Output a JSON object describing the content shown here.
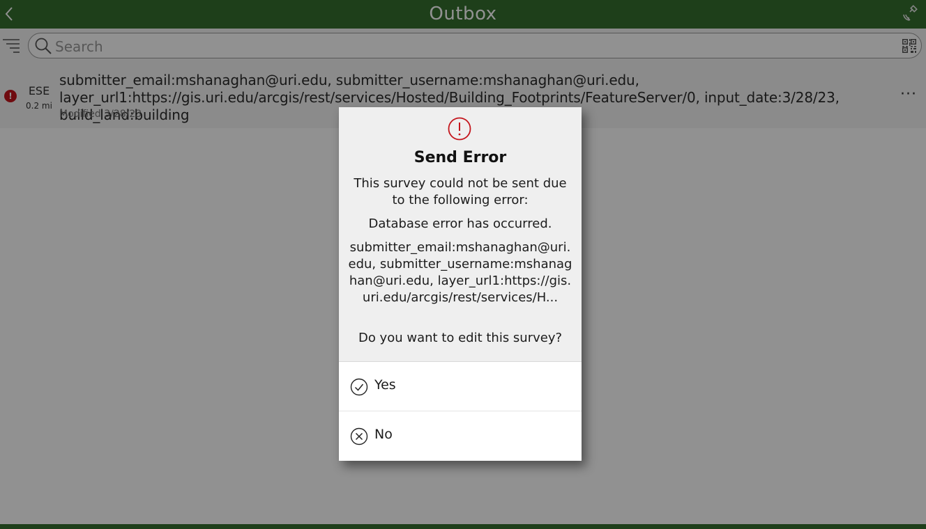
{
  "header": {
    "title": "Outbox",
    "back_icon": "chevron-left-icon",
    "gps_icon": "gps-satellite-icon"
  },
  "search": {
    "placeholder": "Search",
    "value": "",
    "filter_icon": "filter-list-icon",
    "qr_icon": "qr-code-icon"
  },
  "list": {
    "items": [
      {
        "status_icon": "error-icon",
        "direction": "ESE",
        "distance": "0.2 mi",
        "text": "submitter_email:mshanaghan@uri.edu, submitter_username:mshanaghan@uri.edu, layer_url1:https://gis.uri.edu/arcgis/rest/services/Hosted/Building_Footprints/FeatureServer/0, input_date:3/28/23, build_land:building",
        "modified": "Modified 3/28/23",
        "more_label": "···"
      }
    ]
  },
  "dialog": {
    "title": "Send Error",
    "message": "This survey could not be sent due to the following error:",
    "error": "Database error has occurred.",
    "detail": "submitter_email:mshanaghan@uri.edu, submitter_username:mshanaghan@uri.edu, layer_url1:https://gis.uri.edu/arcgis/rest/services/H...",
    "question": "Do you want to edit this survey?",
    "options": [
      {
        "label": "Yes",
        "icon": "check-circle-icon"
      },
      {
        "label": "No",
        "icon": "x-circle-icon"
      }
    ]
  },
  "colors": {
    "header_green": "#35702e",
    "error_red": "#c4151c",
    "overlay": "rgba(0,0,0,0.43)"
  }
}
